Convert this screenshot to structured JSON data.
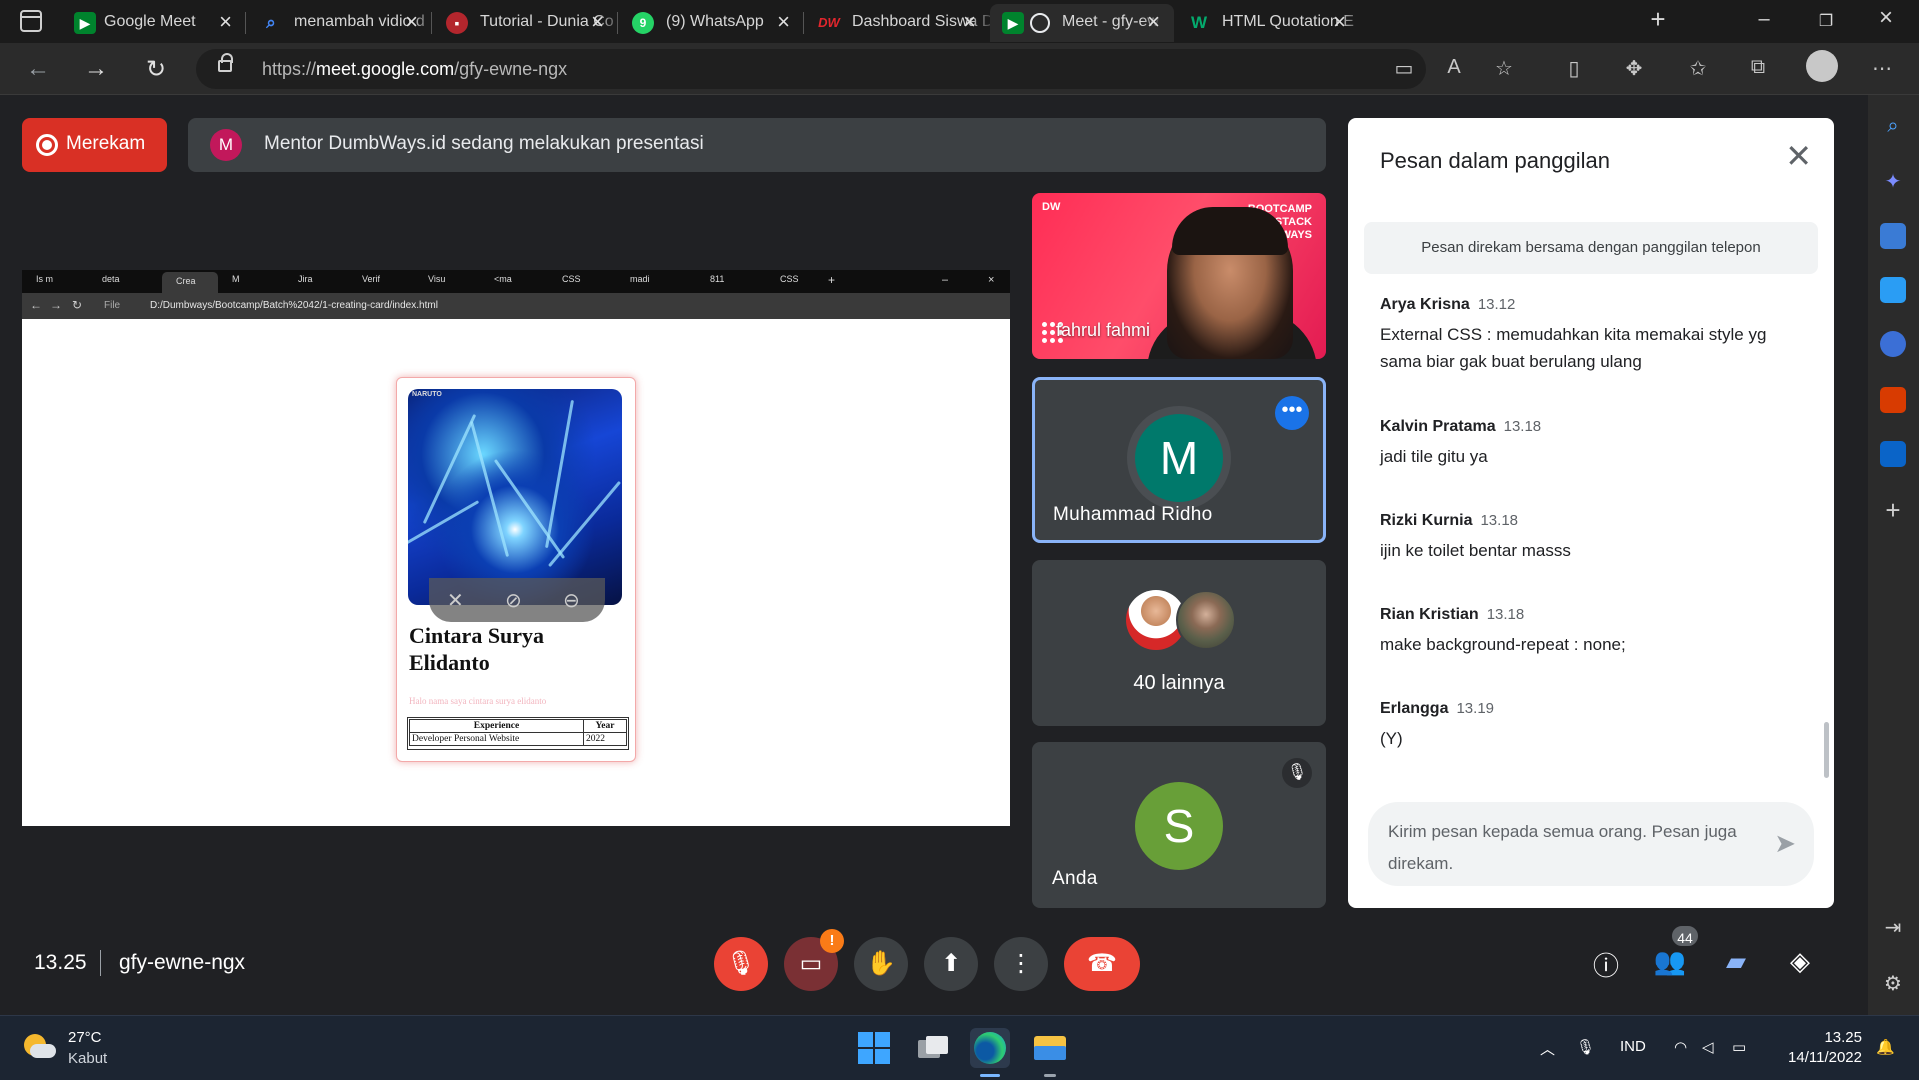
{
  "browser": {
    "tabs": [
      {
        "label": "Google Meet",
        "icon": "google-meet-icon",
        "color": "#00832d"
      },
      {
        "label": "menambah vidio d",
        "icon": "search-icon",
        "color": "#4285f4"
      },
      {
        "label": "Tutorial - Dunia Co",
        "icon": "course-icon",
        "color": "#b3262d"
      },
      {
        "label": "(9) WhatsApp",
        "icon": "whatsapp-icon",
        "color": "#25d366"
      },
      {
        "label": "Dashboard Siswa D",
        "icon": "dumbways-icon",
        "color": "#e3262d"
      },
      {
        "label": "Meet - gfy-ew",
        "icon": "google-meet-icon",
        "color": "#00832d"
      },
      {
        "label": "HTML Quotation E",
        "icon": "w3schools-icon",
        "color": "#04aa6d"
      }
    ],
    "url_prefix": "https://",
    "url_host": "meet.google.com",
    "url_path": "/gfy-ewne-ngx"
  },
  "meet": {
    "record_label": "Merekam",
    "presenter_initial": "M",
    "presenting_text": "Mentor DumbWays.id sedang melakukan presentasi",
    "meeting_time": "13.25",
    "meeting_code": "gfy-ewne-ngx",
    "participant_count": "44",
    "warning_badge": "!"
  },
  "shared_screen": {
    "tabs": [
      "Is m",
      "deta",
      "Crea",
      "M",
      "Jira",
      "Verif",
      "Visu",
      "<ma",
      "CSS",
      "madi",
      "811",
      "CSS"
    ],
    "file_label": "File",
    "url": "D:/Dumbways/Bootcamp/Batch%2042/1-creating-card/index.html",
    "image_tag": "NARUTO",
    "card_name": "Cintara Surya Elidanto",
    "card_desc": "Halo nama saya cintara surya elidanto",
    "table_headers": [
      "Experience",
      "Year"
    ],
    "table_rows": [
      [
        "Developer Personal Website",
        "2022"
      ]
    ]
  },
  "tiles": {
    "video_name": "fahrul fahmi",
    "video_badge_brand": "DW",
    "video_badge_lines": "BOOTCAMP FULLSTACK DUMBWAYS",
    "ridho_initial": "M",
    "ridho_name": "Muhammad Ridho",
    "ridho_color": "#00796b",
    "others_label": "40 lainnya",
    "anda_initial": "S",
    "anda_name": "Anda",
    "anda_color": "#689f38"
  },
  "chat": {
    "title": "Pesan dalam panggilan",
    "note": "Pesan direkam bersama dengan panggilan telepon",
    "messages": [
      {
        "sender": "Arya Krisna",
        "time": "13.12",
        "text": "External CSS : memudahkan kita memakai style yg sama biar gak buat berulang ulang"
      },
      {
        "sender": "Kalvin Pratama",
        "time": "13.18",
        "text": "jadi tile gitu ya"
      },
      {
        "sender": "Rizki Kurnia",
        "time": "13.18",
        "text": "ijin ke toilet bentar masss"
      },
      {
        "sender": "Rian Kristian",
        "time": "13.18",
        "text": "make background-repeat : none;"
      },
      {
        "sender": "Erlangga",
        "time": "13.19",
        "text": "(Y)"
      }
    ],
    "input_placeholder": "Kirim pesan kepada semua orang. Pesan juga direkam."
  },
  "taskbar": {
    "temperature": "27°C",
    "condition": "Kabut",
    "language": "IND",
    "clock_time": "13.25",
    "clock_date": "14/11/2022"
  },
  "colors": {
    "meet_bg": "#202124",
    "record_red": "#d93025",
    "hangup_red": "#ea4335",
    "accent_blue": "#1a73e8"
  }
}
